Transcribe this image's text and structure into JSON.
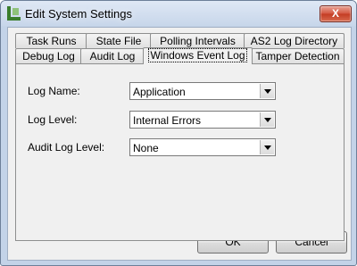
{
  "window": {
    "title": "Edit System Settings",
    "close_label": "X"
  },
  "tabs": {
    "row_back": [
      "Task Runs",
      "State File",
      "Polling Intervals",
      "AS2 Log Directory"
    ],
    "row_front": [
      "Debug Log",
      "Audit Log",
      "Windows Event Log",
      "Tamper Detection"
    ],
    "active": "Windows Event Log"
  },
  "fields": {
    "log_name": {
      "label": "Log Name:",
      "value": "Application"
    },
    "log_level": {
      "label": "Log Level:",
      "value": "Internal Errors"
    },
    "audit_log_level": {
      "label": "Audit Log Level:",
      "value": "None"
    }
  },
  "buttons": {
    "ok": "OK",
    "cancel": "Cancel"
  },
  "colors": {
    "frame": "#c3d3e8",
    "close": "#c33b22",
    "app_icon": "#3a7d2c"
  },
  "icons": {
    "app": "app-icon",
    "close": "close-icon",
    "dropdown": "chevron-down-icon"
  }
}
